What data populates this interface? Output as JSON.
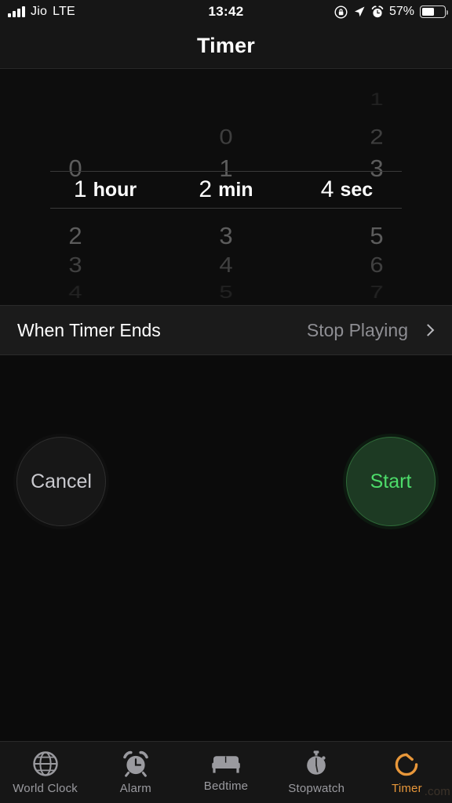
{
  "status_bar": {
    "carrier": "Jio",
    "network": "LTE",
    "time": "13:42",
    "battery_percent": "57%",
    "battery_level": 57,
    "icons": [
      "signal-bars-icon",
      "rotation-lock-icon",
      "location-arrow-icon",
      "alarm-icon",
      "battery-icon"
    ]
  },
  "navbar": {
    "title": "Timer"
  },
  "picker": {
    "hours": {
      "above": [
        "",
        "",
        "0"
      ],
      "selected_number": "1",
      "selected_unit": "hour",
      "below": [
        "2",
        "3",
        "4"
      ]
    },
    "minutes": {
      "above": [
        "",
        "0",
        "1"
      ],
      "selected_number": "2",
      "selected_unit": "min",
      "below": [
        "3",
        "4",
        "5"
      ]
    },
    "seconds": {
      "above": [
        "",
        "1",
        "2",
        "3"
      ],
      "above_r3": "1",
      "above_r2": "2",
      "above_r1": "3",
      "selected_number": "4",
      "selected_unit": "sec",
      "below": [
        "5",
        "6",
        "7"
      ]
    }
  },
  "when_timer_ends": {
    "label": "When Timer Ends",
    "value": "Stop Playing"
  },
  "controls": {
    "cancel_label": "Cancel",
    "start_label": "Start",
    "start_color": "#4ddc6a",
    "cancel_color": "#c9c9ce"
  },
  "tabbar": {
    "active_color": "#e8973a",
    "inactive_color": "#9a9a9f",
    "items": [
      {
        "label": "World Clock",
        "icon": "globe-icon"
      },
      {
        "label": "Alarm",
        "icon": "alarm-clock-icon"
      },
      {
        "label": "Bedtime",
        "icon": "bed-icon"
      },
      {
        "label": "Stopwatch",
        "icon": "stopwatch-icon"
      },
      {
        "label": "Timer",
        "icon": "timer-icon"
      }
    ]
  },
  "watermark": {
    "text": ".com"
  }
}
